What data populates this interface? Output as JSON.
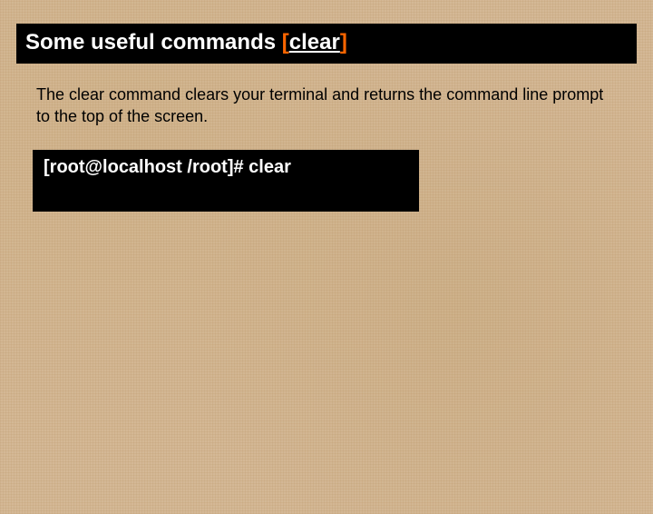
{
  "header": {
    "prefix": "Some useful commands ",
    "bracket_open": "[",
    "command": "clear",
    "bracket_close": "]"
  },
  "description": "The clear command clears your terminal and returns the command line prompt to the top of the screen.",
  "terminal": {
    "prompt": "[root@localhost /root]# clear"
  }
}
